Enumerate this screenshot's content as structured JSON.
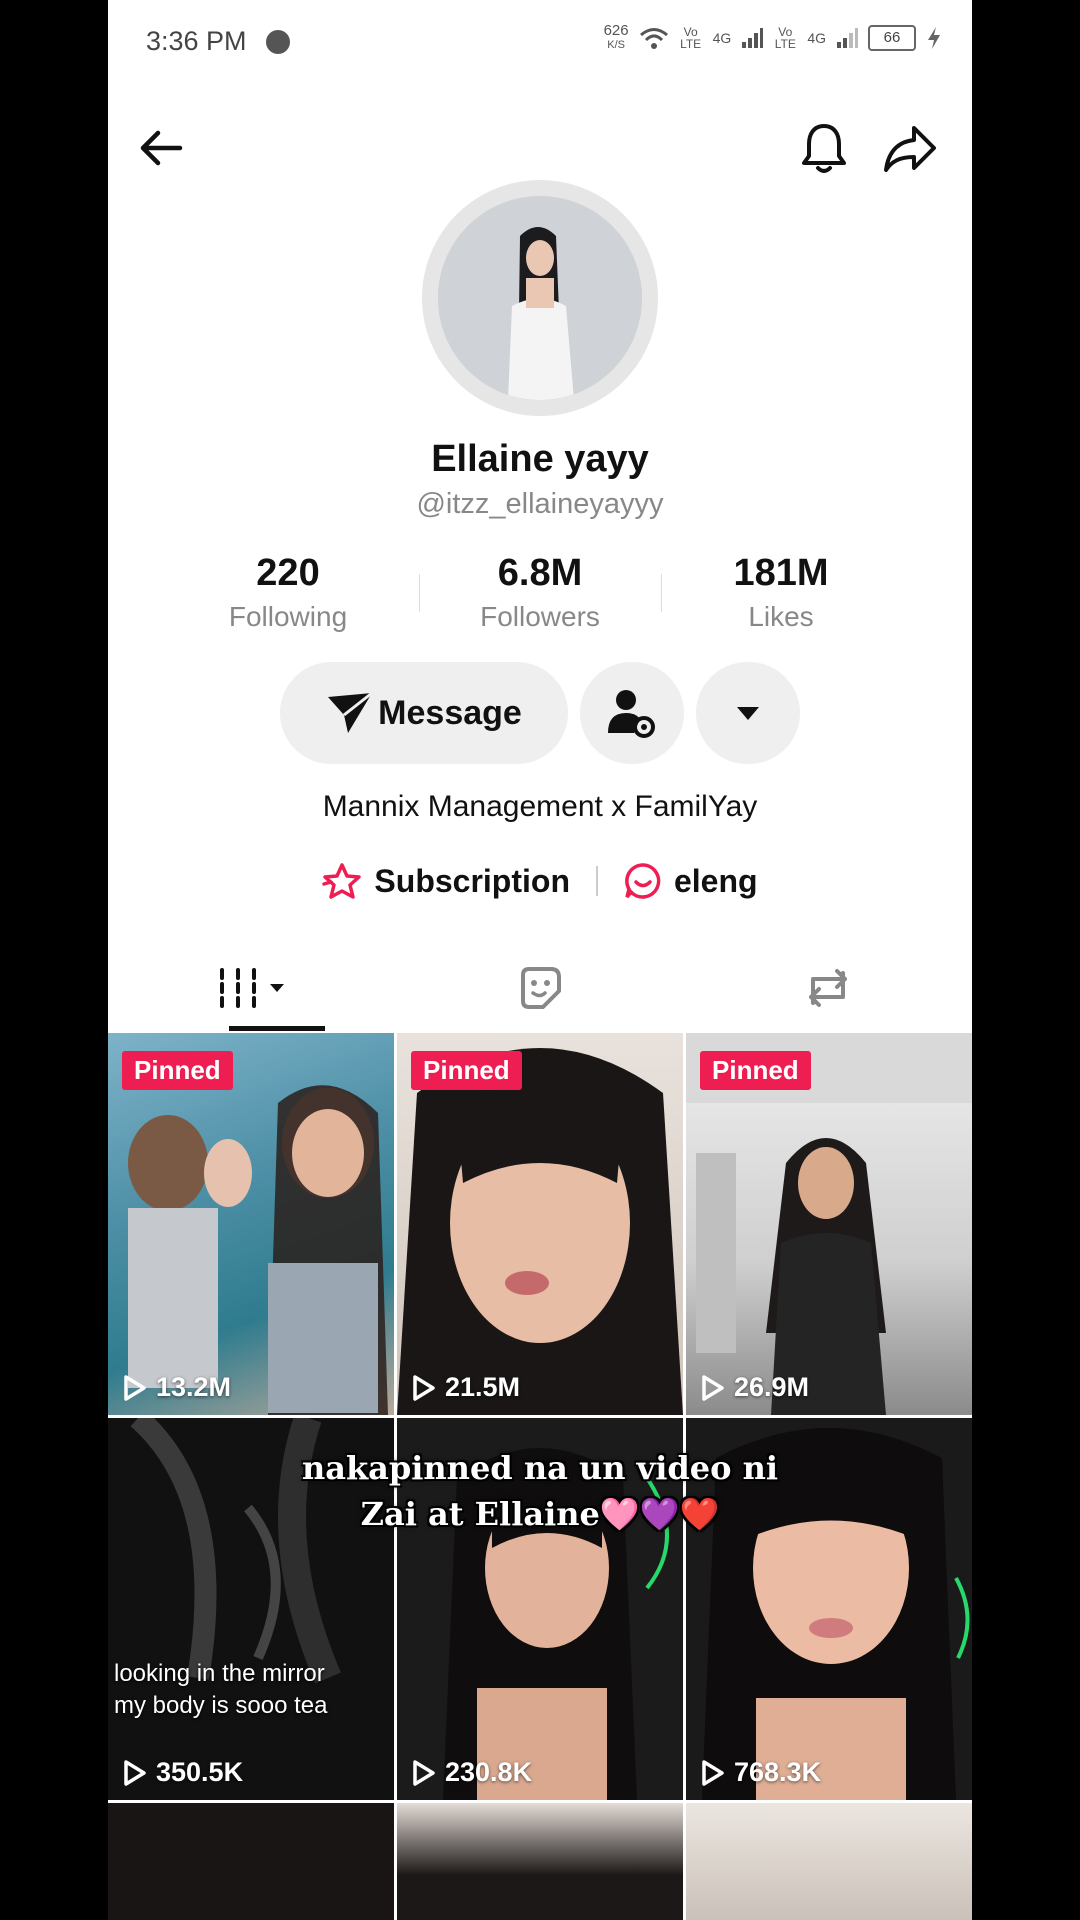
{
  "status_bar": {
    "time": "3:36 PM",
    "net_speed_top": "626",
    "net_speed_unit": "K/S",
    "vo_lte_1": "Vo LTE",
    "net_1": "4G",
    "vo_lte_2": "Vo LTE",
    "net_2": "4G",
    "battery": "66"
  },
  "header": {
    "back": "back-arrow",
    "bell": "bell-icon",
    "share": "share-icon"
  },
  "profile": {
    "name": "Ellaine yayy",
    "handle": "@itzz_ellaineyayyy",
    "stats": [
      {
        "value": "220",
        "label": "Following"
      },
      {
        "value": "6.8M",
        "label": "Followers"
      },
      {
        "value": "181M",
        "label": "Likes"
      }
    ],
    "message_label": "Message",
    "bio": "Mannix Management x FamilYay",
    "links": [
      {
        "label": "Subscription",
        "icon": "star-badge-icon",
        "color": "#ee1d52"
      },
      {
        "label": "eleng",
        "icon": "chat-bubble-icon",
        "color": "#ee1d52"
      }
    ]
  },
  "tabs": [
    "videos-tab",
    "liked-tab",
    "reposts-tab"
  ],
  "videos": [
    {
      "pinned": "Pinned",
      "views": "13.2M"
    },
    {
      "pinned": "Pinned",
      "views": "21.5M"
    },
    {
      "pinned": "Pinned",
      "views": "26.9M"
    },
    {
      "pinned": "",
      "views": "350.5K",
      "caption_1": "looking in the mirror",
      "caption_2": "my body is sooo tea"
    },
    {
      "pinned": "",
      "views": "230.8K"
    },
    {
      "pinned": "",
      "views": "768.3K"
    }
  ],
  "overlay_text": {
    "line1": "nakapinned na un video ni",
    "line2": "Zai at Ellaine🩷💜❤️"
  },
  "colors": {
    "accent": "#ee1d52",
    "text": "#111111",
    "muted": "#888888"
  }
}
